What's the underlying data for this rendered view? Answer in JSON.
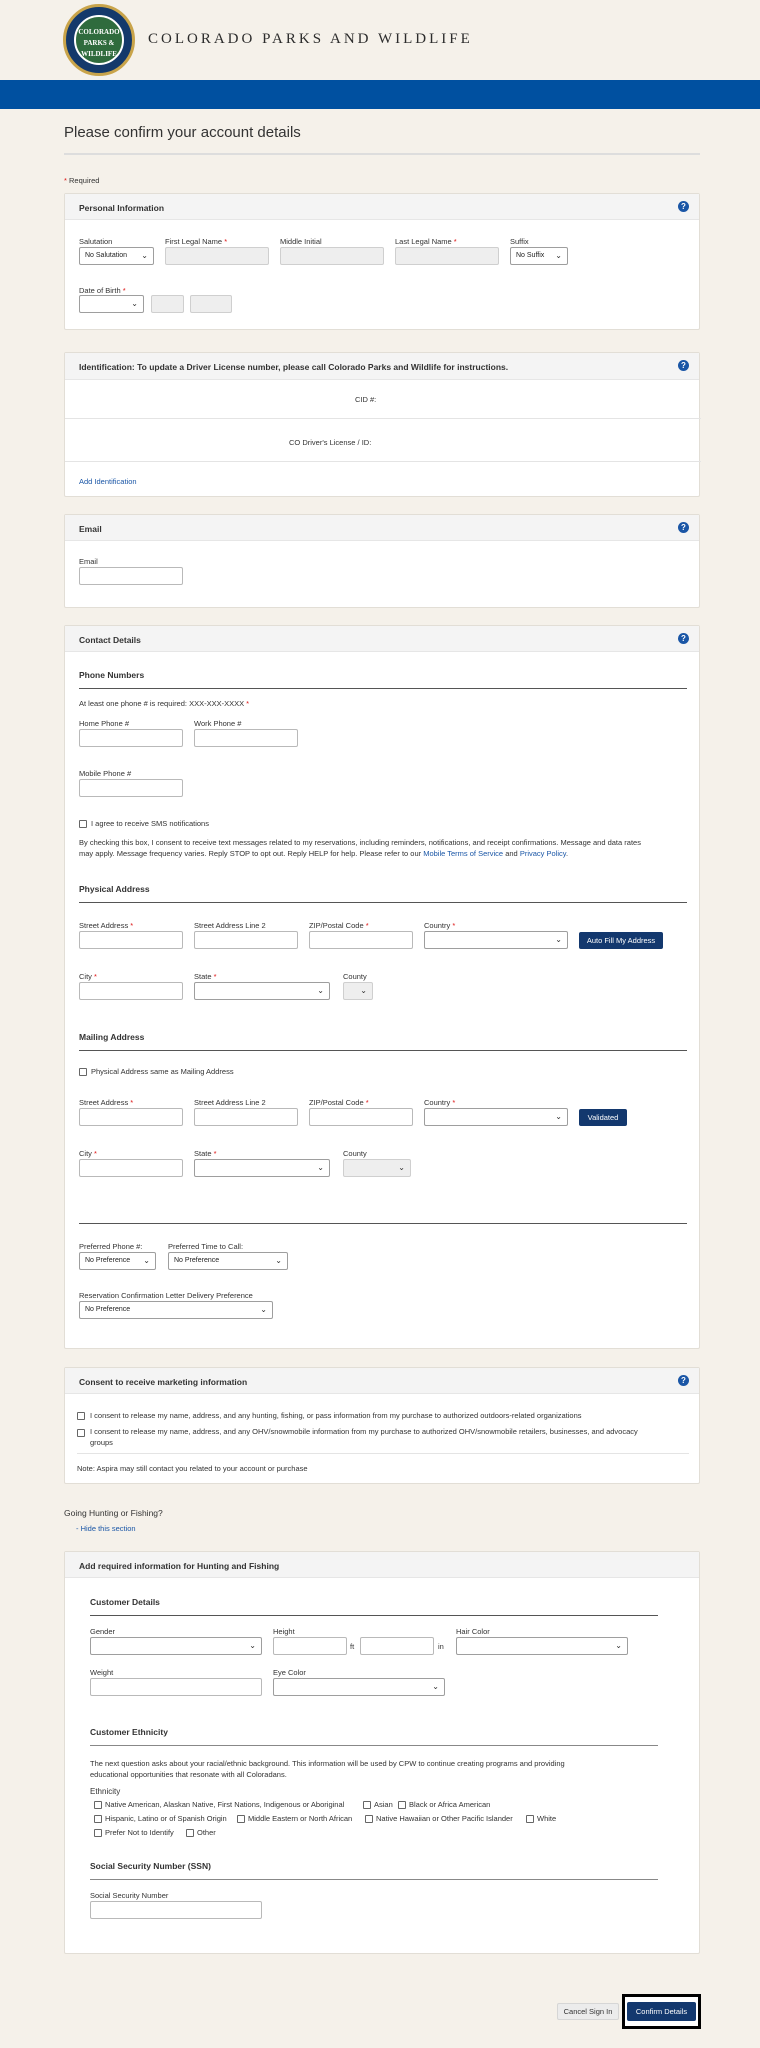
{
  "header": {
    "logo_text": "COLORADO PARKS & WILDLIFE",
    "brand": "COLORADO PARKS AND WILDLIFE",
    "page_title": "Please confirm your account details",
    "required_note": "Required"
  },
  "personal": {
    "title": "Personal Information",
    "salutation_label": "Salutation",
    "salutation_value": "No Salutation",
    "first_label": "First Legal Name",
    "middle_label": "Middle Initial",
    "last_label": "Last Legal Name",
    "suffix_label": "Suffix",
    "suffix_value": "No Suffix",
    "dob_label": "Date of Birth"
  },
  "identification": {
    "title": "Identification: To update a Driver License number, please call Colorado Parks and Wildlife for instructions.",
    "cid_label": "CID #:",
    "dl_label": "CO Driver's License / ID:",
    "add_link": "Add Identification"
  },
  "email": {
    "title": "Email",
    "label": "Email"
  },
  "contact": {
    "title": "Contact Details",
    "phone_title": "Phone Numbers",
    "phone_required": "At least one phone # is required: XXX-XXX-XXXX",
    "home_label": "Home Phone #",
    "work_label": "Work Phone #",
    "mobile_label": "Mobile Phone #",
    "sms_label": "I agree to receive SMS notifications",
    "sms_text_1": "By checking this box, I consent to receive text messages related to my reservations, including reminders, notifications, and receipt confirmations. Message and data rates",
    "sms_text_2": "may apply. Message frequency varies. Reply STOP to opt out. Reply HELP for help. Please refer to our",
    "sms_link_1": "Mobile Terms of Service",
    "sms_and": "and",
    "sms_link_2": "Privacy Policy",
    "physical_title": "Physical Address",
    "street_label": "Street Address",
    "street2_label": "Street Address Line 2",
    "zip_label": "ZIP/Postal Code",
    "country_label": "Country",
    "autofill_button": "Auto Fill My Address",
    "city_label": "City",
    "state_label": "State",
    "county_label": "County",
    "mailing_title": "Mailing Address",
    "same_label": "Physical Address same as Mailing Address",
    "validated_button": "Validated",
    "pref_phone_label": "Preferred Phone #:",
    "pref_phone_value": "No Preference",
    "pref_time_label": "Preferred Time to Call:",
    "pref_time_value": "No Preference",
    "letter_label": "Reservation Confirmation Letter Delivery Preference",
    "letter_value": "No Preference"
  },
  "marketing": {
    "title": "Consent to receive marketing information",
    "consent_1": "I consent to release my name, address, and any hunting, fishing, or pass information from my purchase to authorized outdoors-related organizations",
    "consent_2a": "I consent to release my name, address, and any OHV/snowmobile information from my purchase to authorized OHV/snowmobile retailers, businesses, and advocacy",
    "consent_2b": "groups",
    "note": "Note: Aspira may still contact you related to your account or purchase"
  },
  "hunting": {
    "question": "Going Hunting or Fishing?",
    "hide_link": "- Hide this section",
    "title": "Add required information for Hunting and Fishing",
    "customer_title": "Customer Details",
    "gender_label": "Gender",
    "height_label": "Height",
    "ft": "ft",
    "in": "in",
    "hair_label": "Hair Color",
    "weight_label": "Weight",
    "eye_label": "Eye Color",
    "ethnicity_title": "Customer Ethnicity",
    "ethnicity_text_1": "The next question asks about your racial/ethnic background. This information will be used by CPW to continue creating programs and providing",
    "ethnicity_text_2": "educational opportunities that resonate with all Coloradans.",
    "ethnicity_label": "Ethnicity",
    "options": [
      "Native American, Alaskan Native, First Nations, Indigenous or Aboriginal",
      "Asian",
      "Black or Africa American",
      "Hispanic, Latino or of Spanish Origin",
      "Middle Eastern or North African",
      "Native Hawaiian or Other Pacific Islander",
      "White",
      "Prefer Not to Identify",
      "Other"
    ],
    "ssn_title": "Social Security Number (SSN)",
    "ssn_label": "Social Security Number"
  },
  "footer": {
    "cancel": "Cancel Sign In",
    "confirm": "Confirm Details"
  }
}
